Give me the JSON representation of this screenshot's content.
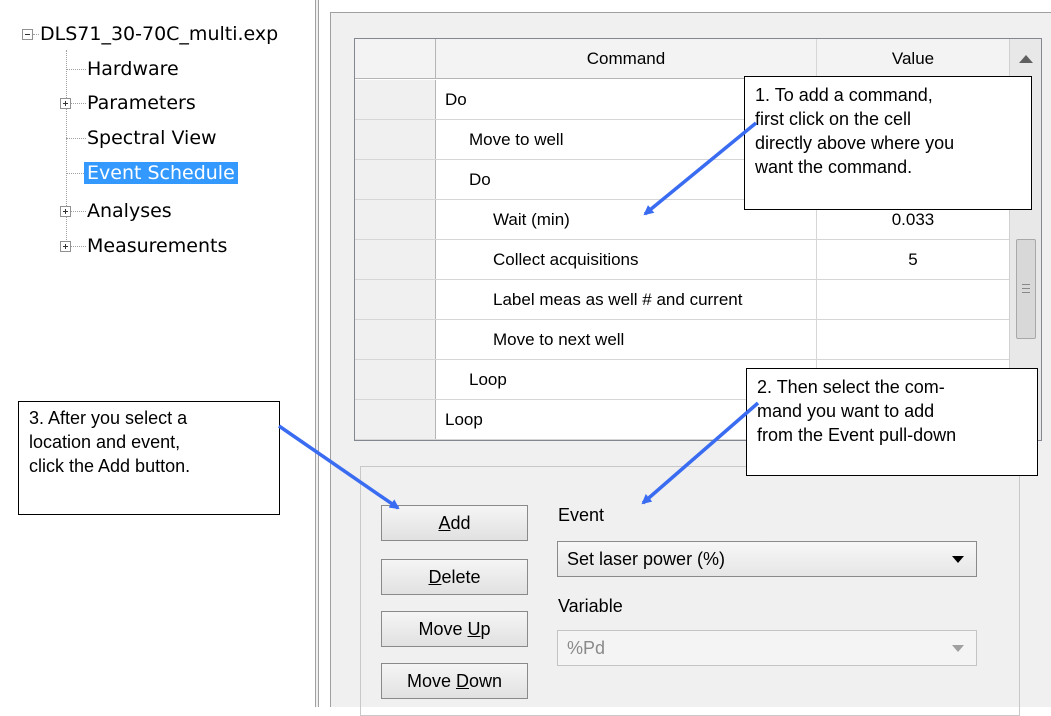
{
  "tree": {
    "root": "DLS71_30-70C_multi.exp",
    "items": [
      {
        "label": "Hardware",
        "expandable": false,
        "selected": false
      },
      {
        "label": "Parameters",
        "expandable": true,
        "selected": false
      },
      {
        "label": "Spectral View",
        "expandable": false,
        "selected": false
      },
      {
        "label": "Event Schedule",
        "expandable": false,
        "selected": true
      },
      {
        "label": "Analyses",
        "expandable": true,
        "selected": false
      },
      {
        "label": "Measurements",
        "expandable": true,
        "selected": false
      }
    ]
  },
  "grid": {
    "headers": {
      "command": "Command",
      "value": "Value"
    },
    "rows": [
      {
        "command": "Do",
        "value": "",
        "indent": 0
      },
      {
        "command": "Move to well",
        "value": "",
        "indent": 1
      },
      {
        "command": "Do",
        "value": "",
        "indent": 1
      },
      {
        "command": "Wait (min)",
        "value": "0.033",
        "indent": 2
      },
      {
        "command": "Collect acquisitions",
        "value": "5",
        "indent": 2
      },
      {
        "command": "Label meas as well # and current",
        "value": "",
        "indent": 2
      },
      {
        "command": "Move to next well",
        "value": "",
        "indent": 2
      },
      {
        "command": "Loop",
        "value": "",
        "indent": 1
      },
      {
        "command": "Loop",
        "value": "",
        "indent": 0
      }
    ]
  },
  "buttons": {
    "add": {
      "pre": "",
      "u": "A",
      "post": "dd"
    },
    "delete": {
      "pre": "",
      "u": "D",
      "post": "elete"
    },
    "move_up": {
      "pre": "Move ",
      "u": "U",
      "post": "p"
    },
    "move_down": {
      "pre": "Move ",
      "u": "D",
      "post": "own"
    }
  },
  "event": {
    "label": "Event",
    "value": "Set laser power (%)"
  },
  "variable": {
    "label": "Variable",
    "value": "%Pd"
  },
  "callouts": {
    "c1": [
      "1. To add a command,",
      "first click on the cell",
      "directly above where you",
      "want the command."
    ],
    "c2": [
      "2. Then select the com-",
      "mand you want to add",
      "from the Event pull-down"
    ],
    "c3": [
      "3. After you select a",
      "location and event,",
      "click the Add button."
    ]
  },
  "colors": {
    "selection": "#3399ff",
    "arrow": "#3a6cf2"
  }
}
